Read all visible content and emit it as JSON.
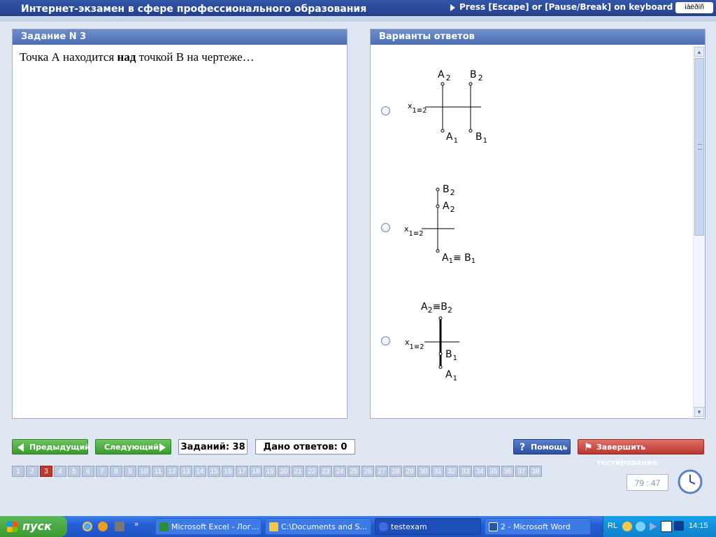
{
  "window": {
    "title": "Интернет-экзамен в сфере профессионального образования",
    "escape_hint": "Press [Escape] or [Pause/Break] on keyboard to stop",
    "keyboard_indicator": "ìàëðíñ"
  },
  "task": {
    "header": "Задание N 3",
    "question_pre": "Точка А находится ",
    "question_bold": "над",
    "question_post": " точкой В на чертеже…"
  },
  "answers": {
    "header": "Варианты ответов",
    "options": [
      {
        "labels": {
          "a_front": "A",
          "a_front_sub": "2",
          "b_front": "B",
          "b_front_sub": "2",
          "axis": "x",
          "axis_sub": "1≡2",
          "a_top": "A",
          "a_top_sub": "1",
          "b_top": "B",
          "b_top_sub": "1"
        }
      },
      {
        "labels": {
          "b_front": "B",
          "b_front_sub": "2",
          "a_front": "A",
          "a_front_sub": "2",
          "axis": "x",
          "axis_sub": "1≡2",
          "top": "A",
          "top_sub": "1",
          "top_eq": "≡ B",
          "top_eq_sub": "1"
        }
      },
      {
        "labels": {
          "front": "A",
          "front_sub": "2",
          "front_eq": "≡B",
          "front_eq_sub": "2",
          "axis": "x",
          "axis_sub": "1≡2",
          "b_top": "B",
          "b_top_sub": "1",
          "a_top": "A",
          "a_top_sub": "1"
        }
      }
    ]
  },
  "controls": {
    "prev_label": "Предыдущий",
    "next_label": "Следующий",
    "tasks_count": "Заданий: 38",
    "answers_given": "Дано ответов: 0",
    "help_label": "Помощь",
    "finish_label": "Завершить тестирование",
    "timer": "79 : 47"
  },
  "question_numbers": [
    "1",
    "2",
    "3",
    "4",
    "5",
    "6",
    "7",
    "8",
    "9",
    "10",
    "11",
    "12",
    "13",
    "14",
    "15",
    "16",
    "17",
    "18",
    "19",
    "20",
    "21",
    "22",
    "23",
    "24",
    "25",
    "26",
    "27",
    "28",
    "29",
    "30",
    "31",
    "32",
    "33",
    "34",
    "35",
    "36",
    "37",
    "38"
  ],
  "current_question": "3",
  "taskbar": {
    "start_label": "пуск",
    "tasks": [
      {
        "label": "Microsoft Excel - Лог...",
        "icon": "excel-icon",
        "color": "#2e8b3a"
      },
      {
        "label": "C:\\Documents and S...",
        "icon": "folder-icon",
        "color": "#f2c84b"
      },
      {
        "label": "testexam",
        "icon": "app-icon",
        "color": "#4169e1"
      },
      {
        "label": "2 - Microsoft Word",
        "icon": "word-icon",
        "color": "#2b579a"
      }
    ],
    "lang": "RL",
    "clock": "14:15"
  },
  "colors": {
    "accent": "#23408c",
    "active_number": "#c0392b",
    "finish_button": "#b8372f",
    "nav_button": "#3a9a2e"
  }
}
